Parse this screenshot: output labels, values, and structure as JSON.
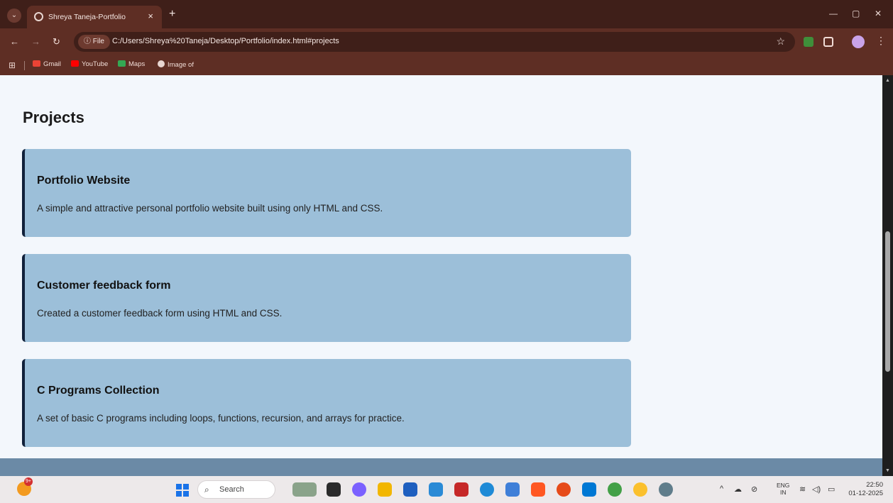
{
  "browser": {
    "tab_title": "Shreya Taneja-Portfolio",
    "tab_close": "×",
    "new_tab": "+",
    "file_chip": "ⓘ File",
    "url": "C:/Users/Shreya%20Taneja/Desktop/Portfolio/index.html#projects",
    "bookmarks": [
      "Gmail",
      "YouTube",
      "Maps",
      "Image of"
    ]
  },
  "page": {
    "heading": "Projects",
    "projects": [
      {
        "title": "Portfolio Website",
        "description": "A simple and attractive personal portfolio website built using only HTML and CSS."
      },
      {
        "title": "Customer feedback form",
        "description": "Created a customer feedback form using HTML and CSS."
      },
      {
        "title": "C Programs Collection",
        "description": "A set of basic C programs including loops, functions, recursion, and arrays for practice."
      }
    ]
  },
  "taskbar": {
    "weather_badge": "9+",
    "search_placeholder": "Search",
    "lang_top": "ENG",
    "lang_bottom": "IN",
    "time": "22:50",
    "date": "01-12-2025"
  },
  "colors": {
    "card_background": "#9cbfd9",
    "card_accent": "#10203a",
    "page_background": "#f3f7fc",
    "footer_band": "#6b8aa6",
    "browser_frame": "#5e2e24"
  }
}
